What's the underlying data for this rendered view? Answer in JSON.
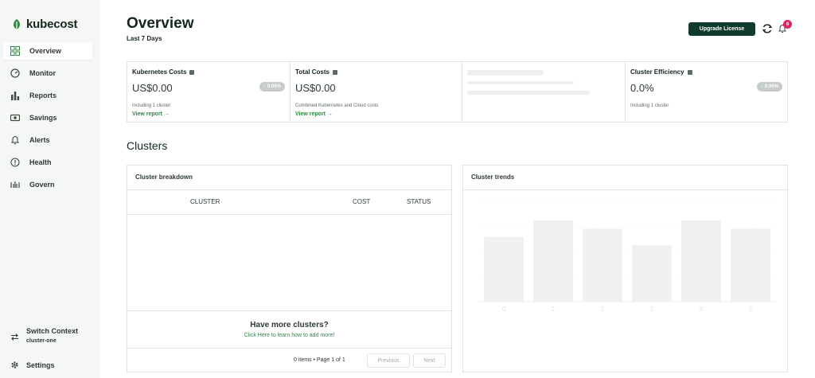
{
  "sidebar": {
    "logo": "kubecost",
    "items": [
      {
        "label": "Overview",
        "icon": "grid-icon",
        "active": true
      },
      {
        "label": "Monitor",
        "icon": "gauge-icon",
        "active": false
      },
      {
        "label": "Reports",
        "icon": "bar-chart-icon",
        "active": false
      },
      {
        "label": "Savings",
        "icon": "cash-icon",
        "active": false
      },
      {
        "label": "Alerts",
        "icon": "bell-icon",
        "active": false
      },
      {
        "label": "Health",
        "icon": "info-circle-icon",
        "active": false
      },
      {
        "label": "Govern",
        "icon": "govern-icon",
        "active": false
      }
    ],
    "switch_context": {
      "label": "Switch Context",
      "value": "cluster-one"
    },
    "settings": "Settings"
  },
  "header": {
    "title": "Overview",
    "subtitle": "Last 7 Days",
    "upgrade_label": "Upgrade License",
    "notification_count": "6"
  },
  "cards": [
    {
      "title": "Kubernetes Costs",
      "value": "US$0.00",
      "delta": "0.00%",
      "note": "Including 1 cluster",
      "link": "View report"
    },
    {
      "title": "Total Costs",
      "value": "US$0.00",
      "note": "Combined Kubernetes and Cloud costs",
      "link": "View report"
    },
    {
      "title": "Cluster Efficiency",
      "value": "0.0%",
      "delta": "0.00%",
      "note": "Including 1 cluster"
    }
  ],
  "clusters": {
    "heading": "Clusters",
    "breakdown": {
      "title": "Cluster breakdown",
      "columns": [
        "CLUSTER",
        "COST",
        "STATUS"
      ],
      "rows": [],
      "more_title": "Have more clusters?",
      "more_link": "Click Here to learn how to add more!",
      "pager_text": "0 items • Page 1 of 1",
      "previous": "Previous",
      "next": "Next"
    },
    "trends": {
      "title": "Cluster trends"
    }
  },
  "chart_data": {
    "type": "bar",
    "categories": [
      "0",
      "1",
      "2",
      "3",
      "4",
      "5"
    ],
    "values": [
      78,
      98,
      88,
      68,
      98,
      88
    ],
    "ylim": [
      0,
      120
    ],
    "grid": true,
    "bar_color": "#f0f0f0",
    "label_color": "#e4e6e4"
  },
  "colors": {
    "brand_dark": "#0e3b2b",
    "accent_green": "#2b8a3e",
    "badge_red": "#e0245e"
  }
}
